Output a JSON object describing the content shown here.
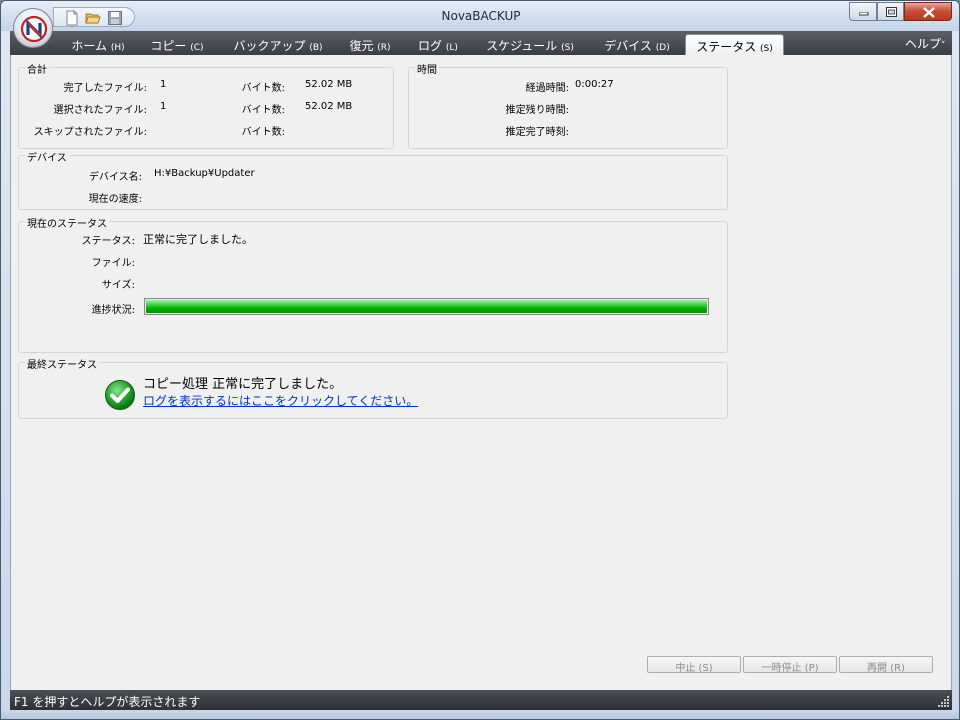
{
  "app": {
    "title": "NovaBACKUP"
  },
  "window_controls": {
    "minimize": "minimize",
    "maximize": "maximize",
    "close": "close"
  },
  "quick_access": [
    {
      "icon": "new-document-icon"
    },
    {
      "icon": "open-folder-icon"
    },
    {
      "icon": "save-icon"
    }
  ],
  "tabs": [
    {
      "label": "ホーム",
      "key": "(H)"
    },
    {
      "label": "コピー",
      "key": "(C)"
    },
    {
      "label": "バックアップ",
      "key": "(B)"
    },
    {
      "label": "復元",
      "key": "(R)"
    },
    {
      "label": "ログ",
      "key": "(L)"
    },
    {
      "label": "スケジュール",
      "key": "(S)"
    },
    {
      "label": "デバイス",
      "key": "(D)"
    },
    {
      "label": "ステータス",
      "key": "(S)",
      "active": true
    }
  ],
  "help": {
    "label": "ヘルプ",
    "caret": "˅"
  },
  "totals": {
    "title": "合計",
    "rows": [
      {
        "label": "完了したファイル:",
        "value": "1",
        "bytes_label": "バイト数:",
        "bytes": "52.02 MB"
      },
      {
        "label": "選択されたファイル:",
        "value": "1",
        "bytes_label": "バイト数:",
        "bytes": "52.02 MB"
      },
      {
        "label": "スキップされたファイル:",
        "value": "",
        "bytes_label": "バイト数:",
        "bytes": ""
      }
    ]
  },
  "time": {
    "title": "時間",
    "rows": [
      {
        "label": "経過時間:",
        "value": "0:00:27"
      },
      {
        "label": "推定残り時間:",
        "value": ""
      },
      {
        "label": "推定完了時刻:",
        "value": ""
      }
    ]
  },
  "device": {
    "title": "デバイス",
    "name_label": "デバイス名:",
    "name": "H:¥Backup¥Updater",
    "speed_label": "現在の速度:",
    "speed": ""
  },
  "current_status": {
    "title": "現在のステータス",
    "status_label": "ステータス:",
    "status": "正常に完了しました。",
    "file_label": "ファイル:",
    "file": "",
    "size_label": "サイズ:",
    "size": "",
    "progress_label": "進捗状況:",
    "progress_fraction": 1.0
  },
  "final_status": {
    "title": "最終ステータス",
    "message": "コピー処理 正常に完了しました。",
    "link": "ログを表示するにはここをクリックしてください。"
  },
  "actions": {
    "stop": "中止 (S)",
    "pause": "一時停止 (P)",
    "resume": "再開 (R)"
  },
  "statusbar": {
    "text": "F1 を押すとヘルプが表示されます"
  },
  "colors": {
    "progress": "#22c422",
    "check": "#1f9a2a",
    "link": "#0033cc"
  }
}
